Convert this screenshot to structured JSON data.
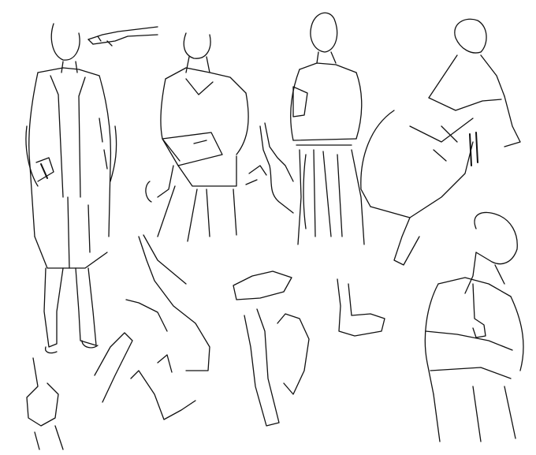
{
  "artwork": {
    "kind": "line-sketch sheet",
    "background": "#ffffff",
    "ink": "#111111"
  }
}
